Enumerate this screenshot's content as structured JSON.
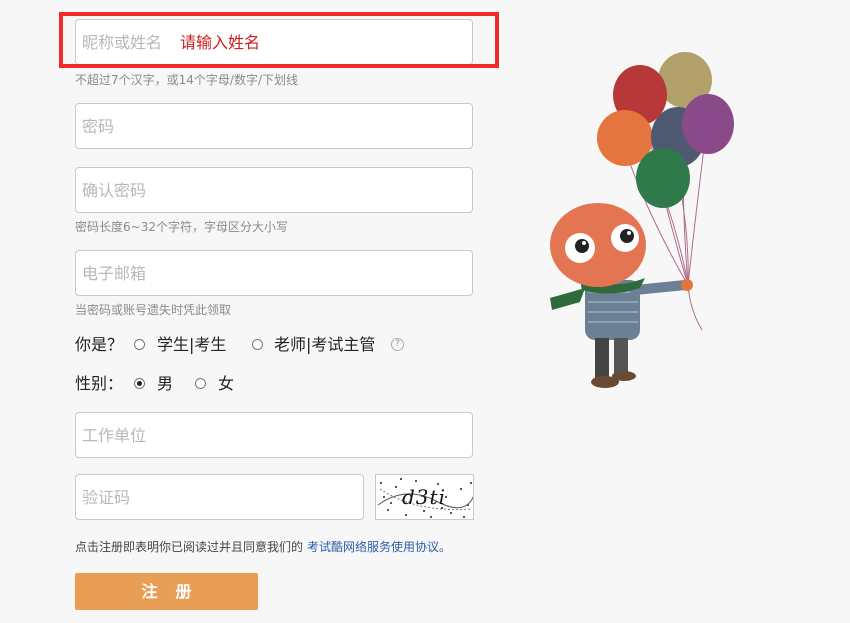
{
  "form": {
    "nickname": {
      "placeholder": "昵称或姓名",
      "error": "请输入姓名",
      "hint": "不超过7个汉字，或14个字母/数字/下划线"
    },
    "password": {
      "placeholder": "密码"
    },
    "confirm_password": {
      "placeholder": "确认密码",
      "hint": "密码长度6~32个字符，字母区分大小写"
    },
    "email": {
      "placeholder": "电子邮箱",
      "hint": "当密码或账号遗失时凭此领取"
    },
    "role": {
      "label": "你是？",
      "options": [
        "学生|考生",
        "老师|考试主管"
      ],
      "help": "?"
    },
    "gender": {
      "label": "性别：",
      "options": [
        "男",
        "女"
      ],
      "selected": "男"
    },
    "workplace": {
      "placeholder": "工作单位"
    },
    "captcha": {
      "placeholder": "验证码",
      "image_text": "d3ti"
    },
    "agreement": {
      "text": "点击注册即表明你已阅读过并且同意我们的",
      "link": "考试酷网络服务使用协议。"
    },
    "submit_label": "注册"
  },
  "colors": {
    "error": "#c81e1e",
    "highlight": "#ee2c2c",
    "button": "#e99e55",
    "link": "#2a5fa8"
  },
  "illustration": {
    "icon": "balloon-mascot"
  }
}
